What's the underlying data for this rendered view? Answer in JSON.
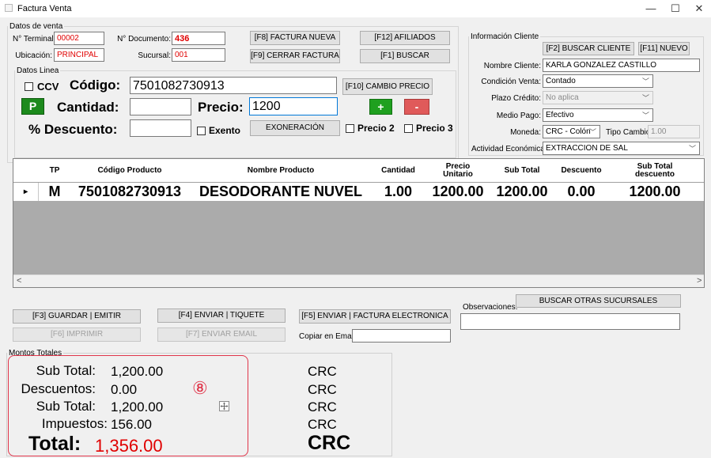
{
  "window": {
    "title": "Factura Venta",
    "minimize": "—",
    "maximize": "☐",
    "close": "✕"
  },
  "datos_venta": {
    "legend": "Datos de venta",
    "terminal_label": "N° Terminal:",
    "terminal_value": "00002",
    "ubicacion_label": "Ubicación:",
    "ubicacion_value": "PRINCIPAL",
    "documento_label": "N° Documento:",
    "documento_value": "436",
    "sucursal_label": "Sucursal:",
    "sucursal_value": "001",
    "btn_f8": "[F8] FACTURA NUEVA",
    "btn_f9": "[F9] CERRAR FACTURA",
    "btn_f12": "[F12] AFILIADOS",
    "btn_f1": "[F1] BUSCAR"
  },
  "datos_linea": {
    "legend": "Datos Linea",
    "ccv_label": "CCV",
    "codigo_label": "Código:",
    "codigo_value": "7501082730913",
    "btn_f10": "[F10] CAMBIO PRECIO",
    "p_button": "P",
    "cantidad_label": "Cantidad:",
    "cantidad_value": "",
    "precio_label": "Precio:",
    "precio_value": "1200",
    "plus": "+",
    "minus": "-",
    "descuento_label": "% Descuento:",
    "descuento_value": "",
    "exento_label": "Exento",
    "btn_exoneracion": "EXONERACIÓN",
    "precio2_label": "Precio 2",
    "precio3_label": "Precio 3"
  },
  "cliente": {
    "legend": "Información Cliente",
    "btn_f2": "[F2] BUSCAR CLIENTE",
    "btn_f11": "[F11] NUEVO",
    "nombre_label": "Nombre Cliente:",
    "nombre_value": "KARLA GONZALEZ CASTILLO",
    "condicion_label": "Condición Venta:",
    "condicion_value": "Contado",
    "plazo_label": "Plazo Crédito:",
    "plazo_value": "No aplica",
    "medio_label": "Medio Pago:",
    "medio_value": "Efectivo",
    "moneda_label": "Moneda:",
    "moneda_value": "CRC - Colón",
    "tipo_cambio_label": "Tipo Cambio:",
    "tipo_cambio_value": "1.00",
    "actividad_label": "Actividad Económica:",
    "actividad_value": "EXTRACCION DE SAL"
  },
  "grid": {
    "headers": [
      "TP",
      "Código Producto",
      "Nombre Producto",
      "Cantidad",
      "Precio Unitario",
      "Sub Total",
      "Descuento",
      "Sub Total descuento"
    ],
    "rows": [
      {
        "indicator": "▸",
        "tp": "M",
        "codigo": "7501082730913",
        "nombre": "DESODORANTE NUVEL",
        "cantidad": "1.00",
        "precio": "1200.00",
        "subtotal": "1200.00",
        "descuento": "0.00",
        "subtotal_desc": "1200.00"
      }
    ],
    "scroll_left": "<",
    "scroll_right": ">"
  },
  "actions": {
    "btn_f3": "[F3] GUARDAR | EMITIR",
    "btn_f4": "[F4] ENVIAR | TIQUETE",
    "btn_f5": "[F5] ENVIAR | FACTURA ELECTRONICA",
    "btn_f6": "[F6] IMPRIMIR",
    "btn_f7": "[F7] ENVIAR EMAIL",
    "copiar_label": "Copiar en Email:",
    "copiar_value": "",
    "observaciones_label": "Observaciones:",
    "observaciones_value": "",
    "btn_otras": "BUSCAR OTRAS SUCURSALES"
  },
  "totales": {
    "legend": "Montos Totales",
    "subtotal_label": "Sub Total:",
    "subtotal_value": "1,200.00",
    "subtotal_cur": "CRC",
    "descuentos_label": "Descuentos:",
    "descuentos_value": "0.00",
    "descuentos_cur": "CRC",
    "subtotal2_label": "Sub Total:",
    "subtotal2_value": "1,200.00",
    "subtotal2_cur": "CRC",
    "impuestos_label": "Impuestos:",
    "impuestos_value": "156.00",
    "impuestos_cur": "CRC",
    "total_label": "Total:",
    "total_value": "1,356.00",
    "total_cur": "CRC",
    "marker": "⑧"
  },
  "colors": {
    "accent_red": "#e00000",
    "highlight_red": "#e0354a",
    "p_button_green": "#1c8a1c",
    "plus_green": "#1fa01f",
    "minus_red": "#e05a5a"
  }
}
